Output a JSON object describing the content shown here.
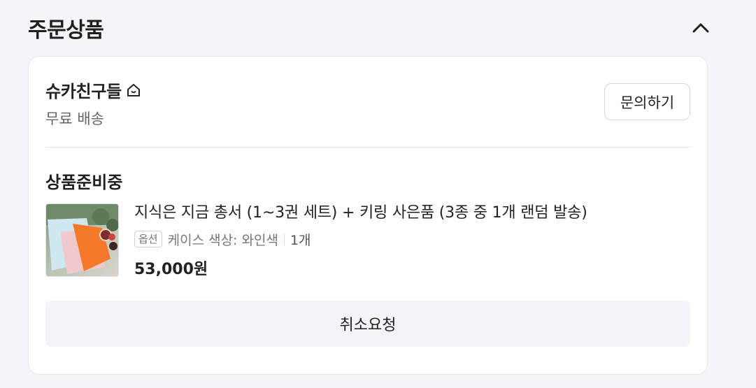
{
  "section": {
    "title": "주문상품"
  },
  "seller": {
    "name": "슈카친구들",
    "shipping": "무료 배송",
    "inquiry_label": "문의하기"
  },
  "order": {
    "status": "상품준비중",
    "product": {
      "title": "지식은 지금 총서 (1~3권 세트) + 키링 사은품 (3종 중 1개 랜덤 발송)",
      "option_badge": "옵션",
      "option_text": "케이스 색상: 와인색",
      "quantity": "1개",
      "price": "53,000원"
    },
    "cancel_label": "취소요청"
  },
  "icons": {
    "collapse": "chevron-up-icon",
    "home": "home-icon"
  }
}
